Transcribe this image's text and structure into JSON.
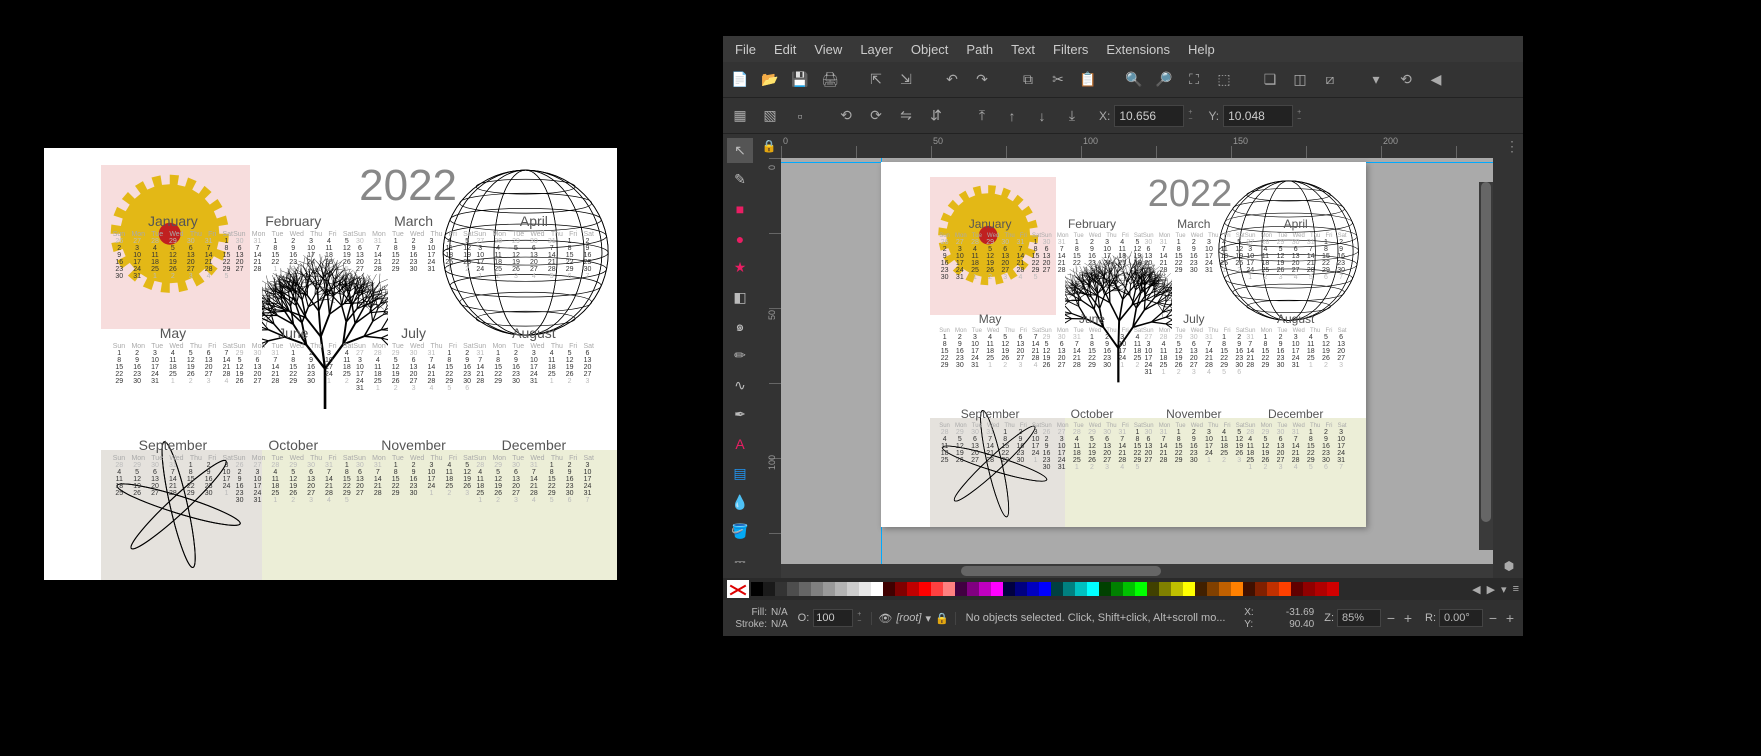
{
  "menubar": [
    "File",
    "Edit",
    "View",
    "Layer",
    "Object",
    "Path",
    "Text",
    "Filters",
    "Extensions",
    "Help"
  ],
  "toolbar1_icons": [
    "new",
    "open",
    "save",
    "print",
    "",
    "import",
    "export",
    "",
    "undo",
    "redo",
    "",
    "copy",
    "cut",
    "paste",
    "",
    "zoom-in",
    "zoom-out",
    "zoom-fit",
    "zoom-sel",
    "",
    "dup",
    "clone",
    "unlink",
    "",
    "more",
    "snap",
    "prefs"
  ],
  "toolbar2": {
    "x_label": "X:",
    "x_value": "10.656",
    "y_label": "Y:",
    "y_value": "10.048"
  },
  "toolbox_icons": [
    "selector",
    "node",
    "rect",
    "circle",
    "star",
    "cube",
    "spiral",
    "pencil",
    "bezier",
    "calligraphy",
    "text",
    "gradient",
    "dropper",
    "bucket",
    "connector"
  ],
  "ruler_h": [
    "0",
    "50",
    "100",
    "150",
    "200"
  ],
  "ruler_v": [
    "0",
    "50",
    "100"
  ],
  "palette_greys": [
    "#000000",
    "#1a1a1a",
    "#333333",
    "#4d4d4d",
    "#666666",
    "#808080",
    "#999999",
    "#b3b3b3",
    "#cccccc",
    "#e6e6e6",
    "#ffffff"
  ],
  "palette_colors": [
    "#400000",
    "#800000",
    "#c00000",
    "#ff0000",
    "#ff4040",
    "#ff8080",
    "#400040",
    "#800080",
    "#c000c0",
    "#ff00ff",
    "#000040",
    "#000080",
    "#0000c0",
    "#0000ff",
    "#004040",
    "#008080",
    "#00c0c0",
    "#00ffff",
    "#004000",
    "#008000",
    "#00c000",
    "#00ff00",
    "#404000",
    "#808000",
    "#c0c000",
    "#ffff00",
    "#402000",
    "#804000",
    "#c06000",
    "#ff8000",
    "#401000",
    "#802000",
    "#c03000",
    "#ff4000",
    "#600000",
    "#900000",
    "#b00000",
    "#d00000"
  ],
  "status": {
    "fill_label": "Fill:",
    "fill_value": "N/A",
    "stroke_label": "Stroke:",
    "stroke_value": "N/A",
    "opacity_label": "O:",
    "opacity_value": "100",
    "layer_name": "[root]",
    "hint": "No objects selected. Click, Shift+click, Alt+scroll mo...",
    "x_label": "X:",
    "x_value": "-31.69",
    "y_label": "Y:",
    "y_value": "90.40",
    "z_label": "Z:",
    "z_value": "85%",
    "r_label": "R:",
    "r_value": "0.00°"
  },
  "calendar": {
    "year": "2022",
    "dow": [
      "Sun",
      "Mon",
      "Tue",
      "Wed",
      "Thu",
      "Fri",
      "Sat"
    ],
    "months": [
      {
        "n": "January",
        "lead": 6,
        "days": 31
      },
      {
        "n": "February",
        "lead": 2,
        "days": 28
      },
      {
        "n": "March",
        "lead": 2,
        "days": 31
      },
      {
        "n": "April",
        "lead": 5,
        "days": 30
      },
      {
        "n": "May",
        "lead": 0,
        "days": 31
      },
      {
        "n": "June",
        "lead": 3,
        "days": 30
      },
      {
        "n": "July",
        "lead": 5,
        "days": 31
      },
      {
        "n": "August",
        "lead": 1,
        "days": 31
      },
      {
        "n": "September",
        "lead": 4,
        "days": 30
      },
      {
        "n": "October",
        "lead": 6,
        "days": 31
      },
      {
        "n": "November",
        "lead": 2,
        "days": 30
      },
      {
        "n": "December",
        "lead": 4,
        "days": 31
      }
    ]
  }
}
